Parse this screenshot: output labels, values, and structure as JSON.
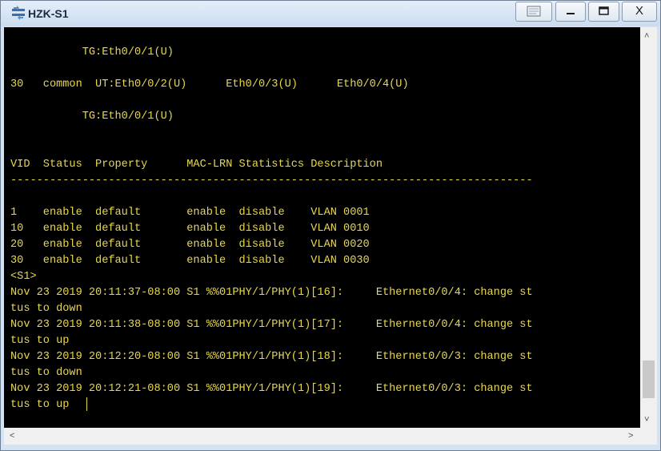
{
  "window": {
    "title": "HZK-S1",
    "icon": "switch-icon",
    "controls": [
      "extra-icon",
      "minimize-icon",
      "maximize-icon",
      "close-icon"
    ],
    "close_label": "X"
  },
  "terminal": {
    "lines": [
      "           TG:Eth0/0/1(U)",
      "",
      "30   common  UT:Eth0/0/2(U)      Eth0/0/3(U)      Eth0/0/4(U)",
      "",
      "           TG:Eth0/0/1(U)",
      "",
      "",
      "VID  Status  Property      MAC-LRN Statistics Description",
      "--------------------------------------------------------------------------------",
      "",
      "1    enable  default       enable  disable    VLAN 0001",
      "10   enable  default       enable  disable    VLAN 0010",
      "20   enable  default       enable  disable    VLAN 0020",
      "30   enable  default       enable  disable    VLAN 0030",
      "<S1>",
      "Nov 23 2019 20:11:37-08:00 S1 %%01PHY/1/PHY(1)[16]:     Ethernet0/0/4: change st",
      "tus to down",
      "Nov 23 2019 20:11:38-08:00 S1 %%01PHY/1/PHY(1)[17]:     Ethernet0/0/4: change st",
      "tus to up",
      "Nov 23 2019 20:12:20-08:00 S1 %%01PHY/1/PHY(1)[18]:     Ethernet0/0/3: change st",
      "tus to down",
      "Nov 23 2019 20:12:21-08:00 S1 %%01PHY/1/PHY(1)[19]:     Ethernet0/0/3: change st",
      "tus to up"
    ]
  },
  "colors": {
    "terminal_bg": "#000000",
    "terminal_text": "#e8d84a",
    "title_text": "#1d2b3c"
  },
  "scrollbars": {
    "vertical_position": 0.96,
    "horizontal_position": 0.0
  }
}
